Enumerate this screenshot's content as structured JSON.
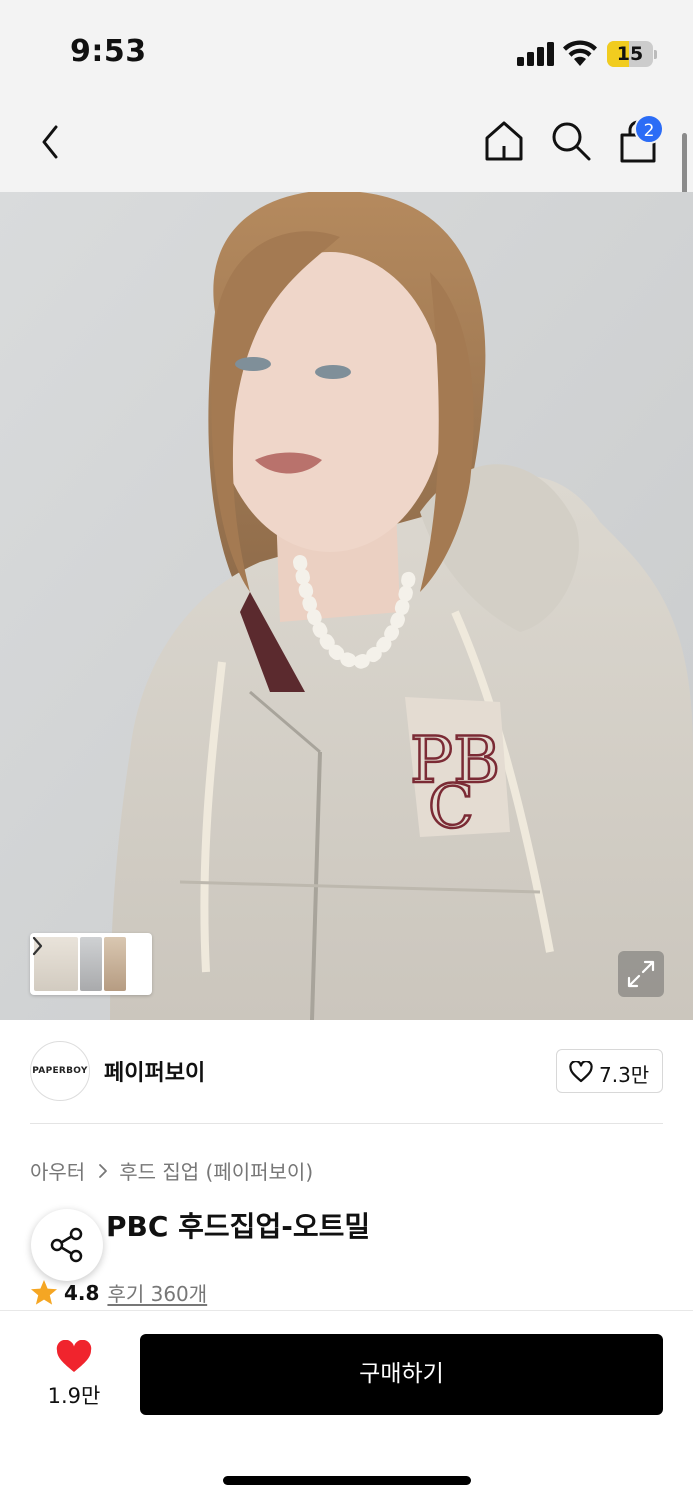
{
  "status_bar": {
    "time": "9:53",
    "battery_level": "15"
  },
  "nav": {
    "cart_count": "2"
  },
  "brand": {
    "logo_text": "PAPERBOY",
    "name": "페이퍼보이",
    "like_count": "7.3만"
  },
  "product": {
    "category": "아우터",
    "subcategory": "후드 집업 (페이퍼보이)",
    "title": "PBC 후드집업-오트밀",
    "rating": "4.8",
    "reviews": "후기 360개"
  },
  "bottom_bar": {
    "wish_count": "1.9만",
    "buy_label": "구매하기"
  },
  "colors": {
    "accent_blue": "#2b6cf6",
    "heart_red": "#f0242d",
    "star_orange": "#f5a623",
    "buy_button": "#000000"
  }
}
